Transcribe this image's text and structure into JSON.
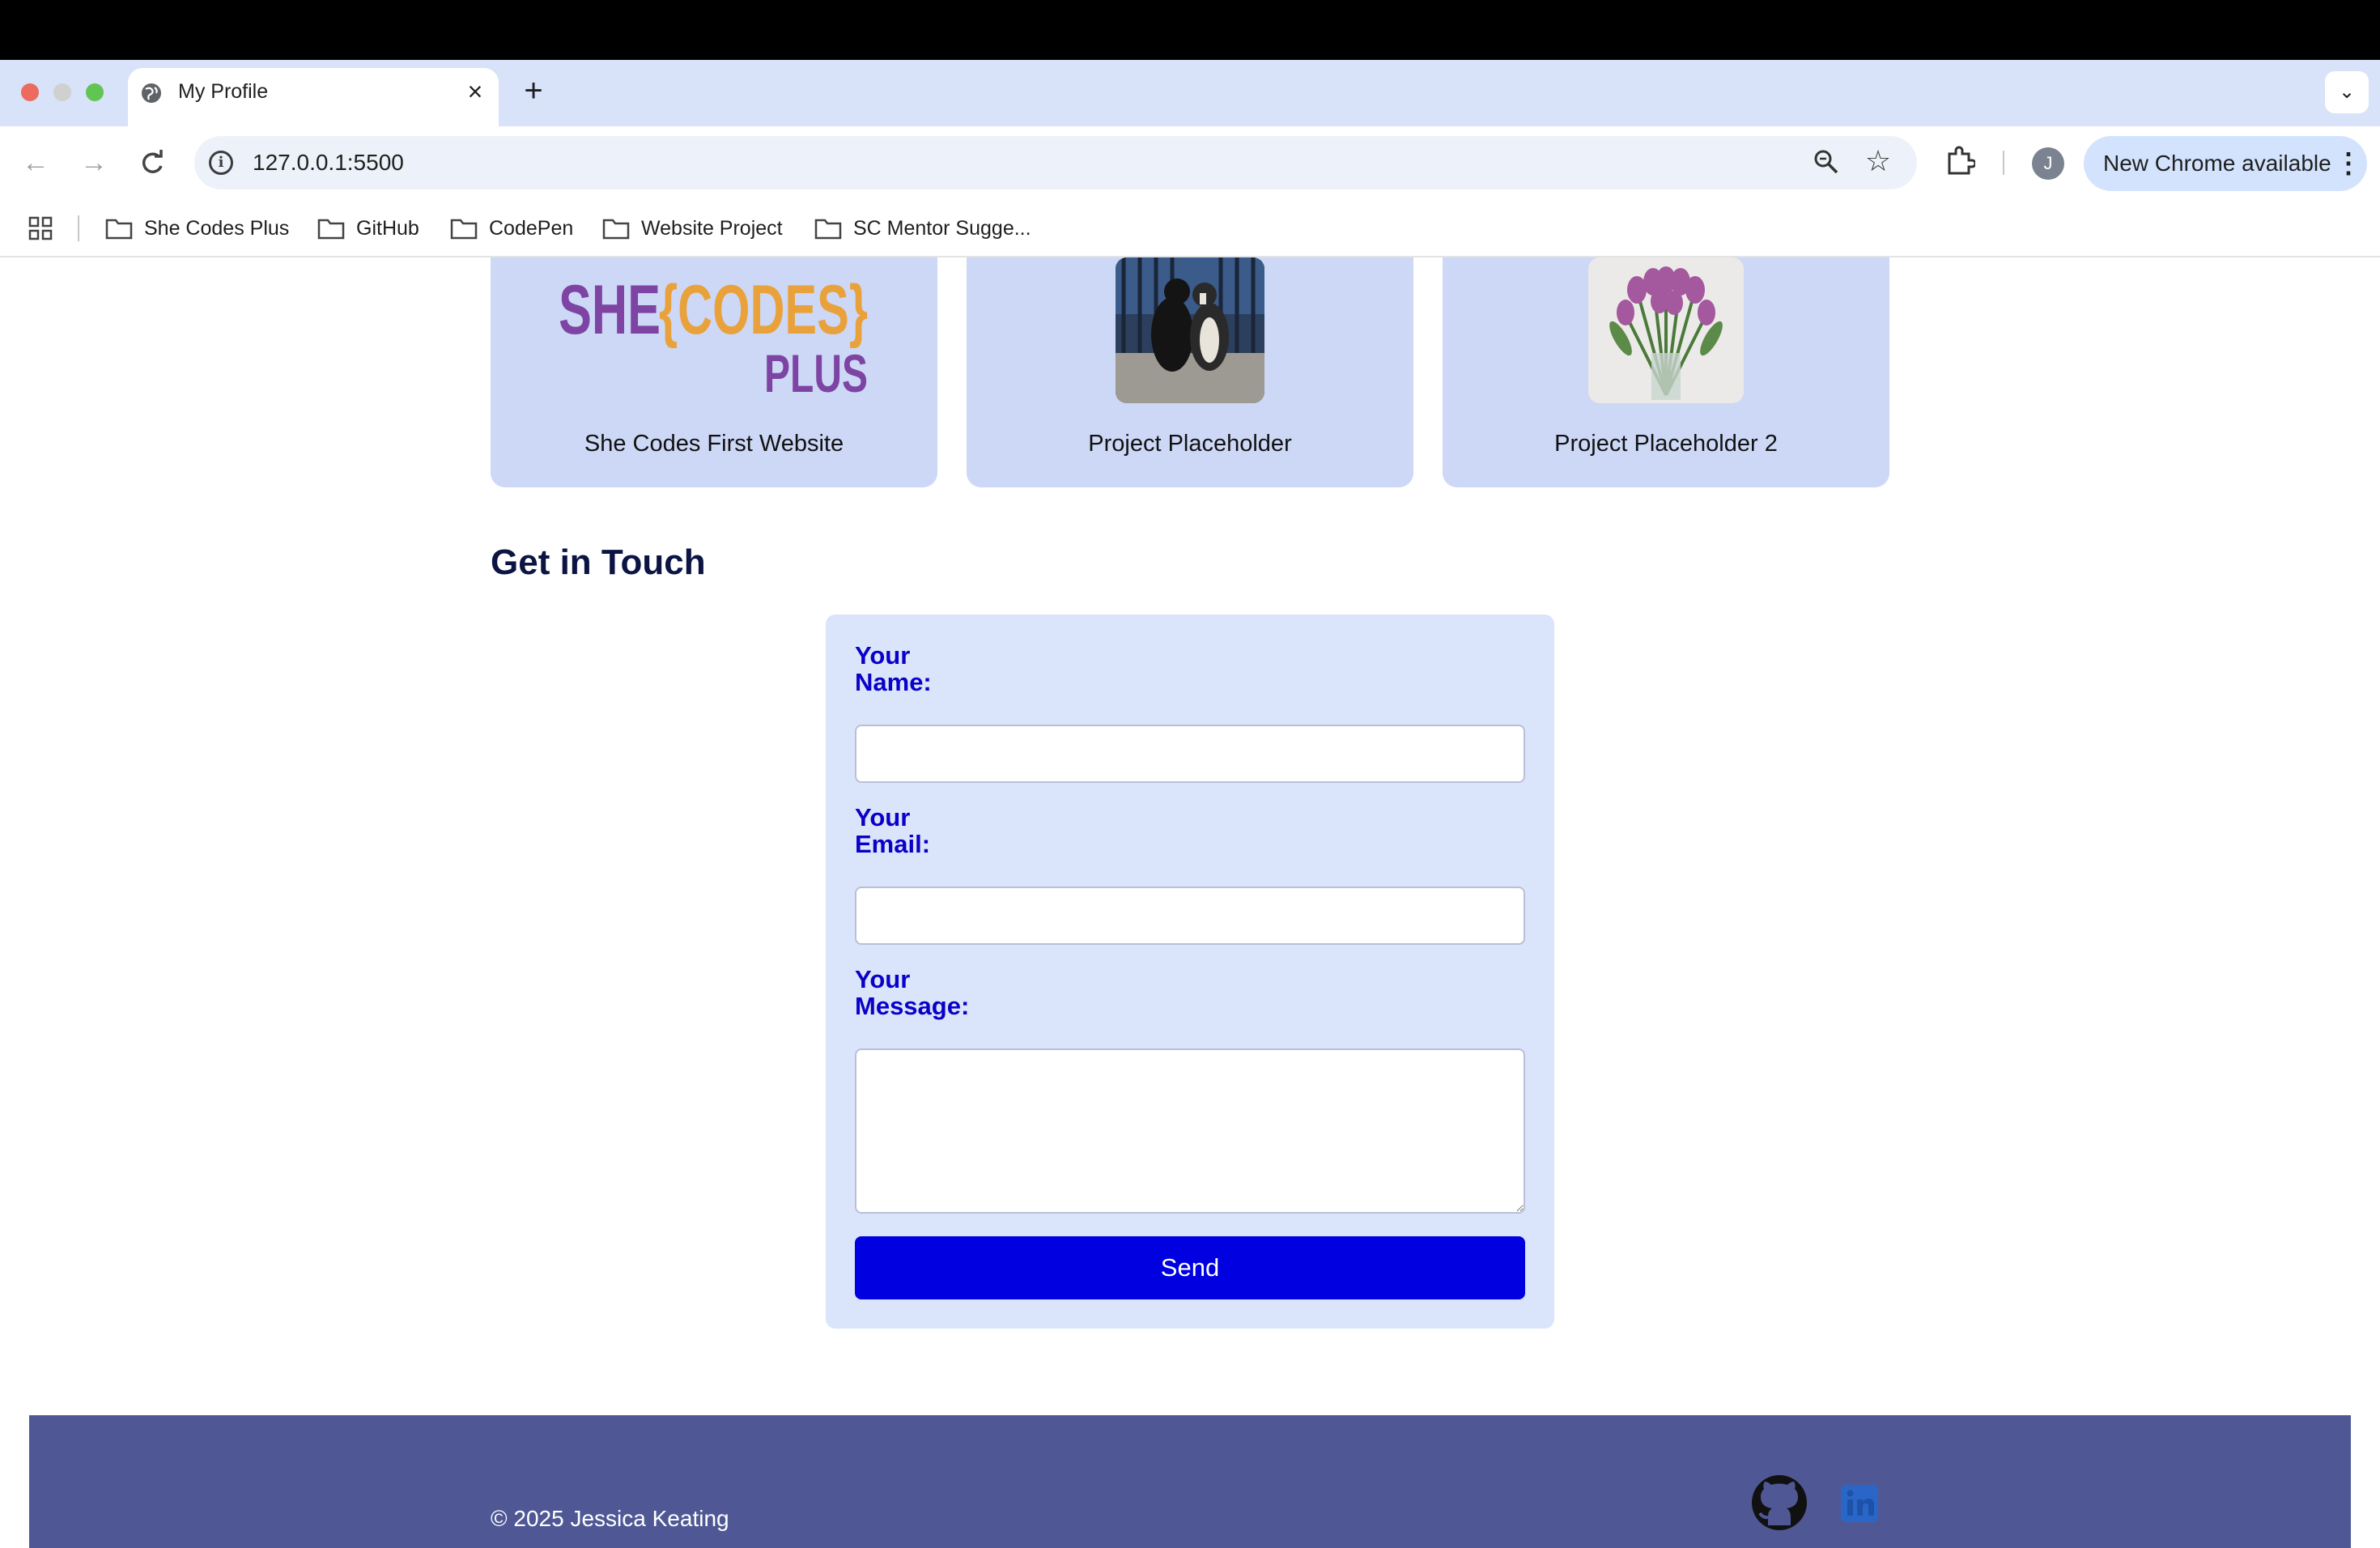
{
  "browser": {
    "tab_title": "My Profile",
    "url": "127.0.0.1:5500",
    "new_chrome_label": "New Chrome available",
    "avatar_initial": "J",
    "bookmarks": [
      "She Codes Plus",
      "GitHub",
      "CodePen",
      "Website Project",
      "SC Mentor Sugge..."
    ]
  },
  "projects": [
    {
      "title": "She Codes First Website",
      "image": "she-codes-plus-logo"
    },
    {
      "title": "Project Placeholder",
      "image": "dogs-photo"
    },
    {
      "title": "Project Placeholder 2",
      "image": "tulips-photo"
    }
  ],
  "logo": {
    "line1_a": "SHE",
    "line1_b": "{CODES}",
    "line2": "PLUS"
  },
  "contact": {
    "heading": "Get in Touch",
    "name_label": "Your\nName:",
    "email_label": "Your\nEmail:",
    "message_label": "Your\nMessage:",
    "name_value": "",
    "email_value": "",
    "message_value": "",
    "send_label": "Send"
  },
  "footer": {
    "copyright": "© 2025 Jessica Keating",
    "icons": [
      "github-icon",
      "linkedin-icon"
    ]
  },
  "colors": {
    "card_bg": "#cdd8f6",
    "form_bg": "#dae4fa",
    "label_color": "#0a00c8",
    "button_bg": "#0000e0",
    "footer_bg": "#4f5895",
    "logo_purple": "#7e44a3",
    "logo_orange": "#e9a23b"
  }
}
